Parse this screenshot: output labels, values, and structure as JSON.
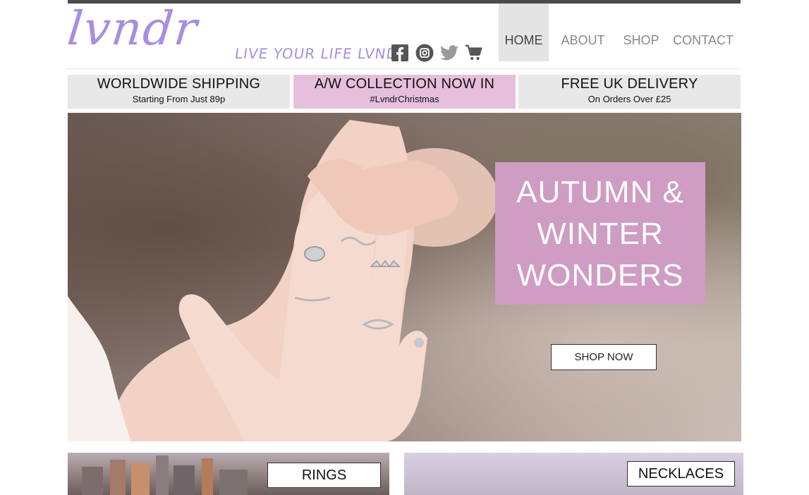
{
  "brand": {
    "logo": "lvndr",
    "tagline": "LIVE YOUR LIFE LVNDR",
    "accent_color": "#a88de0"
  },
  "social": [
    {
      "icon": "facebook-icon"
    },
    {
      "icon": "instagram-icon"
    },
    {
      "icon": "twitter-icon"
    },
    {
      "icon": "shopping-cart-icon"
    }
  ],
  "nav": {
    "items": [
      {
        "label": "HOME",
        "active": true
      },
      {
        "label": "ABOUT",
        "active": false
      },
      {
        "label": "SHOP",
        "active": false
      },
      {
        "label": "CONTACT",
        "active": false
      }
    ]
  },
  "banners": [
    {
      "title": "WORLDWIDE SHIPPING",
      "subtitle": "Starting From Just 89p",
      "color": "#e8e8e8"
    },
    {
      "title": "A/W COLLECTION NOW IN",
      "subtitle": "#LvndrChristmas",
      "color": "#e6bfdc"
    },
    {
      "title": "FREE UK DELIVERY",
      "subtitle": "On Orders Over £25",
      "color": "#e8e8e8"
    }
  ],
  "hero": {
    "headline": [
      "AUTUMN &",
      "WINTER",
      "WONDERS"
    ],
    "cta": "SHOP NOW",
    "box_color": "#cf9cc3"
  },
  "categories": [
    {
      "label": "RINGS"
    },
    {
      "label": "NECKLACES"
    }
  ]
}
